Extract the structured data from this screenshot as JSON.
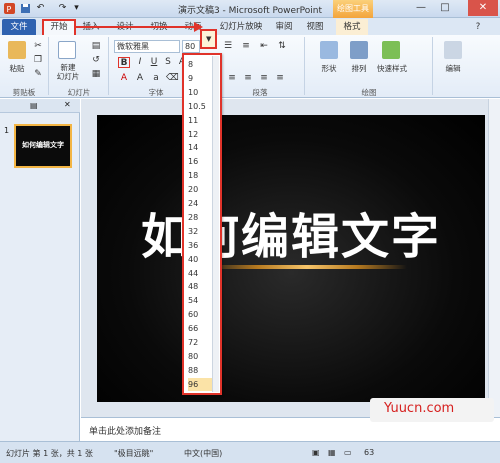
{
  "window": {
    "title": "演示文稿3 - Microsoft PowerPoint",
    "contextual_tab": "绘图工具",
    "minimize": "—",
    "maximize": "□",
    "close": "✕"
  },
  "tabs": [
    {
      "label": "文件"
    },
    {
      "label": "开始"
    },
    {
      "label": "插入"
    },
    {
      "label": "设计"
    },
    {
      "label": "切换"
    },
    {
      "label": "动画"
    },
    {
      "label": "幻灯片放映"
    },
    {
      "label": "审阅"
    },
    {
      "label": "视图"
    },
    {
      "label": "格式"
    }
  ],
  "ribbon": {
    "paste_label": "粘贴",
    "new_slide_label": "新建\n幻灯片",
    "font_name": "微软雅黑",
    "font_size": "80",
    "shapes_label": "形状",
    "arrange_label": "排列",
    "quick_styles_label": "快速样式",
    "edit_label": "编辑",
    "group_clipboard": "剪贴板",
    "group_slides": "幻灯片",
    "group_font": "字体",
    "group_paragraph": "段落",
    "group_drawing": "绘图"
  },
  "font_size_options": [
    "8",
    "9",
    "10",
    "10.5",
    "11",
    "12",
    "14",
    "16",
    "18",
    "20",
    "24",
    "28",
    "32",
    "36",
    "40",
    "44",
    "48",
    "54",
    "60",
    "66",
    "72",
    "80",
    "88",
    "96"
  ],
  "selected_font_size": "96",
  "left_panel": {
    "slide_number": "1",
    "thumb_text": "如何编辑文字"
  },
  "slide": {
    "title": "如何编辑文字"
  },
  "notes_placeholder": "单击此处添加备注",
  "watermark": "Yuucn.com",
  "status": {
    "slide_info": "幻灯片 第 1 张，共 1 张",
    "theme": "\"极目远眺\"",
    "language": "中文(中国)",
    "zoom": "63"
  },
  "colors": {
    "highlight_red": "#e0332a",
    "file_tab": "#2f62b0",
    "thumb_border": "#f3b544"
  }
}
